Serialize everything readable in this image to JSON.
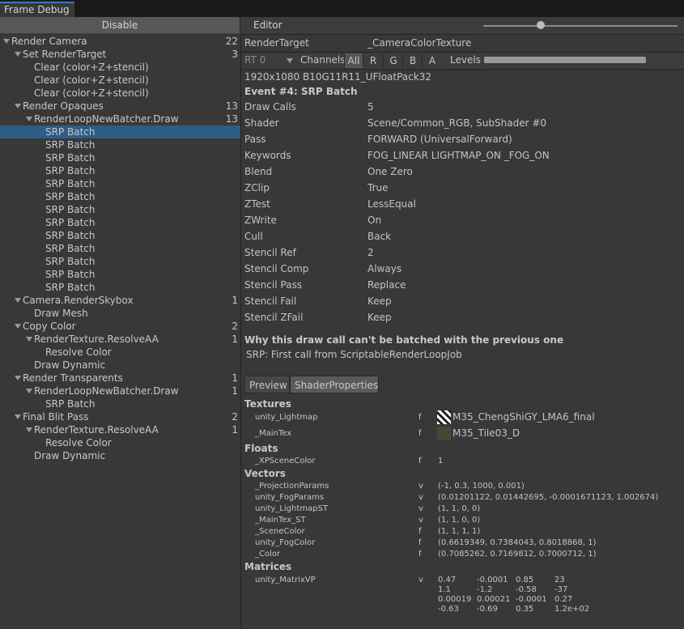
{
  "window": {
    "tab": "Frame Debug"
  },
  "toolbar": {
    "disable_label": "Disable",
    "editor_label": "Editor"
  },
  "tree": [
    {
      "label": "Render Camera",
      "count": "22",
      "level": 0,
      "arrow": true
    },
    {
      "label": "Set RenderTarget",
      "count": "3",
      "level": 1,
      "arrow": true
    },
    {
      "label": "Clear (color+Z+stencil)",
      "count": "",
      "level": 2,
      "arrow": false
    },
    {
      "label": "Clear (color+Z+stencil)",
      "count": "",
      "level": 2,
      "arrow": false
    },
    {
      "label": "Clear (color+Z+stencil)",
      "count": "",
      "level": 2,
      "arrow": false
    },
    {
      "label": "Render Opaques",
      "count": "13",
      "level": 1,
      "arrow": true
    },
    {
      "label": "RenderLoopNewBatcher.Draw",
      "count": "13",
      "level": 2,
      "arrow": true
    },
    {
      "label": "SRP Batch",
      "count": "",
      "level": 3,
      "arrow": false,
      "selected": true
    },
    {
      "label": "SRP Batch",
      "count": "",
      "level": 3,
      "arrow": false
    },
    {
      "label": "SRP Batch",
      "count": "",
      "level": 3,
      "arrow": false
    },
    {
      "label": "SRP Batch",
      "count": "",
      "level": 3,
      "arrow": false
    },
    {
      "label": "SRP Batch",
      "count": "",
      "level": 3,
      "arrow": false
    },
    {
      "label": "SRP Batch",
      "count": "",
      "level": 3,
      "arrow": false
    },
    {
      "label": "SRP Batch",
      "count": "",
      "level": 3,
      "arrow": false
    },
    {
      "label": "SRP Batch",
      "count": "",
      "level": 3,
      "arrow": false
    },
    {
      "label": "SRP Batch",
      "count": "",
      "level": 3,
      "arrow": false
    },
    {
      "label": "SRP Batch",
      "count": "",
      "level": 3,
      "arrow": false
    },
    {
      "label": "SRP Batch",
      "count": "",
      "level": 3,
      "arrow": false
    },
    {
      "label": "SRP Batch",
      "count": "",
      "level": 3,
      "arrow": false
    },
    {
      "label": "SRP Batch",
      "count": "",
      "level": 3,
      "arrow": false
    },
    {
      "label": "Camera.RenderSkybox",
      "count": "1",
      "level": 1,
      "arrow": true
    },
    {
      "label": "Draw Mesh",
      "count": "",
      "level": 2,
      "arrow": false
    },
    {
      "label": "Copy Color",
      "count": "2",
      "level": 1,
      "arrow": true
    },
    {
      "label": "RenderTexture.ResolveAA",
      "count": "1",
      "level": 2,
      "arrow": true
    },
    {
      "label": "Resolve Color",
      "count": "",
      "level": 3,
      "arrow": false
    },
    {
      "label": "Draw Dynamic",
      "count": "",
      "level": 2,
      "arrow": false
    },
    {
      "label": "Render Transparents",
      "count": "1",
      "level": 1,
      "arrow": true
    },
    {
      "label": "RenderLoopNewBatcher.Draw",
      "count": "1",
      "level": 2,
      "arrow": true
    },
    {
      "label": "SRP Batch",
      "count": "",
      "level": 3,
      "arrow": false
    },
    {
      "label": "Final Blit Pass",
      "count": "2",
      "level": 1,
      "arrow": true
    },
    {
      "label": "RenderTexture.ResolveAA",
      "count": "1",
      "level": 2,
      "arrow": true
    },
    {
      "label": "Resolve Color",
      "count": "",
      "level": 3,
      "arrow": false
    },
    {
      "label": "Draw Dynamic",
      "count": "",
      "level": 2,
      "arrow": false
    }
  ],
  "details": {
    "render_target_label": "RenderTarget",
    "render_target_value": "_CameraColorTexture",
    "rt_select": "RT 0",
    "channels_label": "Channels",
    "channels": [
      "All",
      "R",
      "G",
      "B",
      "A"
    ],
    "levels_label": "Levels",
    "resolution": "1920x1080 B10G11R11_UFloatPack32",
    "event_title": "Event #4: SRP Batch",
    "props": [
      {
        "k": "Draw Calls",
        "v": "5"
      },
      {
        "k": "Shader",
        "v": "Scene/Common_RGB, SubShader #0"
      },
      {
        "k": "Pass",
        "v": "FORWARD (UniversalForward)"
      },
      {
        "k": "Keywords",
        "v": "FOG_LINEAR LIGHTMAP_ON _FOG_ON"
      },
      {
        "k": "Blend",
        "v": "One Zero"
      },
      {
        "k": "ZClip",
        "v": "True"
      },
      {
        "k": "ZTest",
        "v": "LessEqual"
      },
      {
        "k": "ZWrite",
        "v": "On"
      },
      {
        "k": "Cull",
        "v": "Back"
      },
      {
        "k": "Stencil Ref",
        "v": "2"
      },
      {
        "k": "Stencil Comp",
        "v": "Always"
      },
      {
        "k": "Stencil Pass",
        "v": "Replace"
      },
      {
        "k": "Stencil Fail",
        "v": "Keep"
      },
      {
        "k": "Stencil ZFail",
        "v": "Keep"
      }
    ],
    "batch_title": "Why this draw call can't be batched with the previous one",
    "batch_reason": "SRP: First call from ScriptableRenderLoopJob",
    "tabs": [
      "Preview",
      "ShaderProperties"
    ],
    "textures_header": "Textures",
    "textures": [
      {
        "name": "unity_Lightmap",
        "stage": "f",
        "value": "M35_ChengShiGY_LMA6_final"
      },
      {
        "name": "_MainTex",
        "stage": "f",
        "value": "M35_Tile03_D"
      }
    ],
    "floats_header": "Floats",
    "floats": [
      {
        "name": "_XPSceneColor",
        "stage": "f",
        "value": "1"
      }
    ],
    "vectors_header": "Vectors",
    "vectors": [
      {
        "name": "_ProjectionParams",
        "stage": "v",
        "value": "(-1, 0.3, 1000, 0.001)"
      },
      {
        "name": "unity_FogParams",
        "stage": "v",
        "value": "(0.01201122, 0.01442695, -0.0001671123, 1.002674)"
      },
      {
        "name": "unity_LightmapST",
        "stage": "v",
        "value": "(1, 1, 0, 0)"
      },
      {
        "name": "_MainTex_ST",
        "stage": "v",
        "value": "(1, 1, 0, 0)"
      },
      {
        "name": "_SceneColor",
        "stage": "f",
        "value": "(1, 1, 1, 1)"
      },
      {
        "name": "unity_FogColor",
        "stage": "f",
        "value": "(0.6619349, 0.7384043, 0.8018868, 1)"
      },
      {
        "name": "_Color",
        "stage": "f",
        "value": "(0.7085262, 0.7169812, 0.7000712, 1)"
      }
    ],
    "matrices_header": "Matrices",
    "matrix": {
      "name": "unity_MatrixVP",
      "stage": "v",
      "rows": [
        [
          "0.47",
          "-0.0001",
          "0.85",
          "23"
        ],
        [
          "1.1",
          "-1.2",
          "-0.58",
          "-37"
        ],
        [
          "0.00019",
          "0.00021",
          "-0.0001",
          "0.27"
        ],
        [
          "-0.63",
          "-0.69",
          "0.35",
          "1.2e+02"
        ]
      ]
    }
  }
}
